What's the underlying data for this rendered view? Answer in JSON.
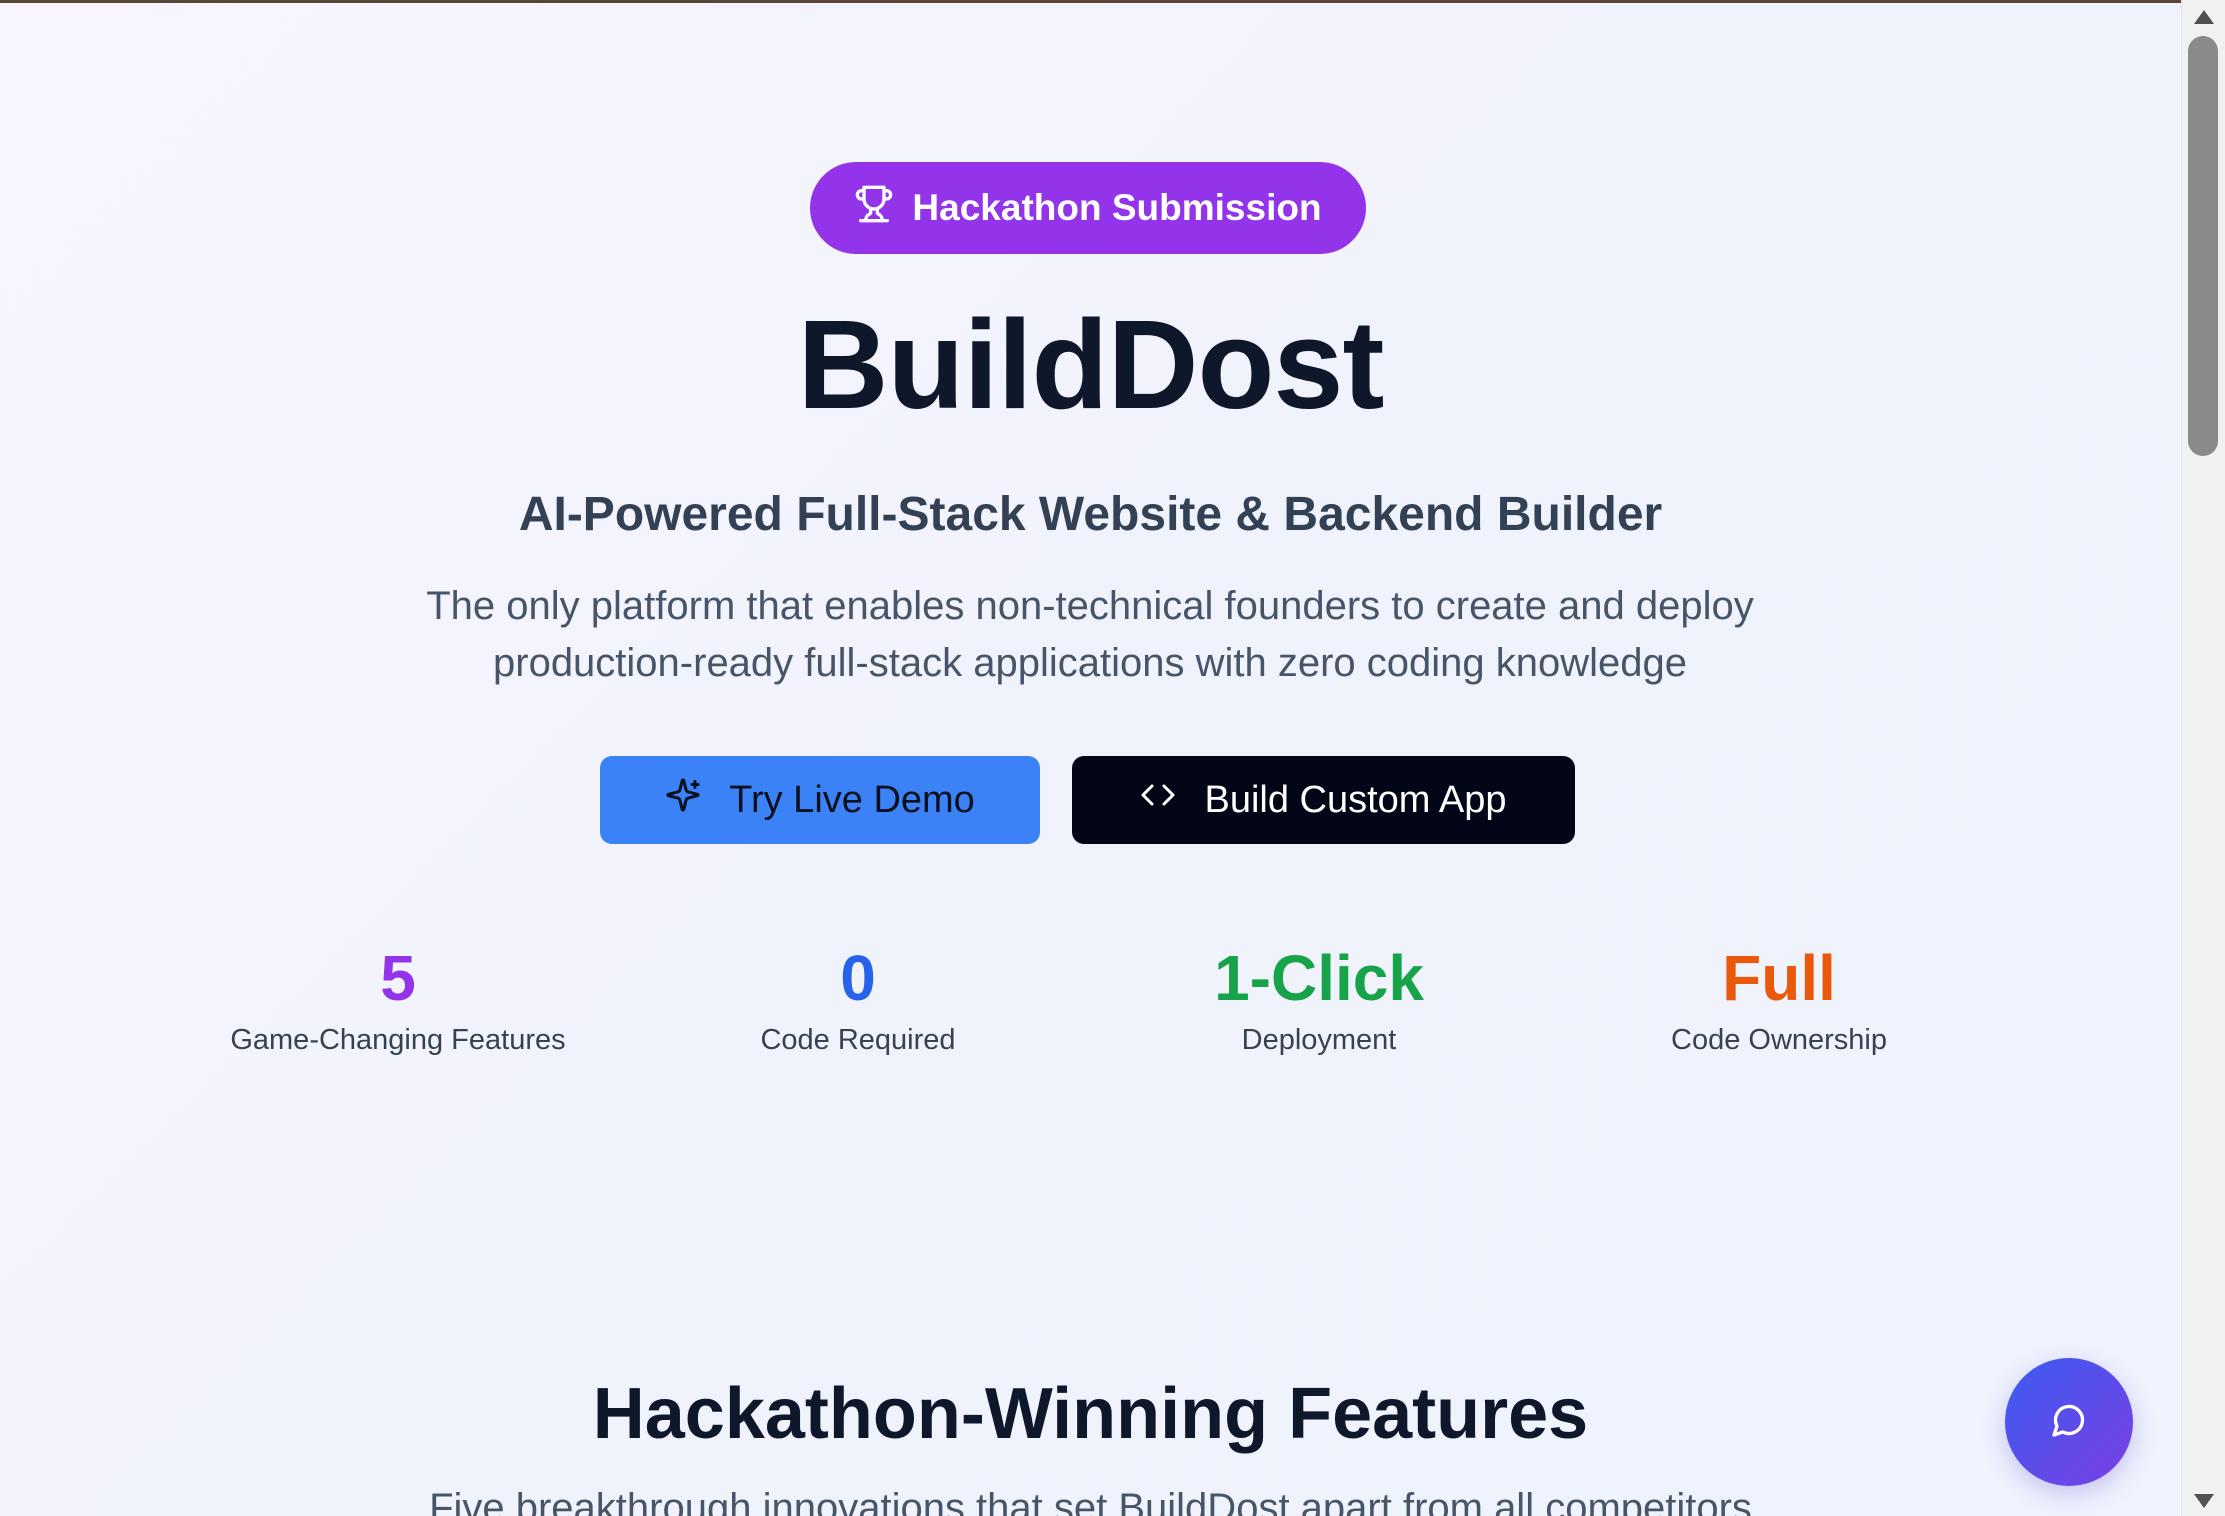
{
  "badge": {
    "label": "Hackathon Submission",
    "icon": "trophy-icon"
  },
  "hero": {
    "title": "BuildDost",
    "subtitle": "AI-Powered Full-Stack Website & Backend Builder",
    "description_line1": "The only platform that enables non-technical founders to create and deploy",
    "description_line2": "production-ready full-stack applications with zero coding knowledge"
  },
  "buttons": {
    "demo": {
      "label": "Try Live Demo",
      "icon": "sparkles-icon"
    },
    "build": {
      "label": "Build Custom App",
      "icon": "code-icon"
    }
  },
  "stats": [
    {
      "value": "5",
      "label": "Game-Changing Features",
      "color": "#9333ea"
    },
    {
      "value": "0",
      "label": "Code Required",
      "color": "#2563eb"
    },
    {
      "value": "1-Click",
      "label": "Deployment",
      "color": "#16a34a"
    },
    {
      "value": "Full",
      "label": "Code Ownership",
      "color": "#ea580c"
    }
  ],
  "features": {
    "title": "Hackathon-Winning Features",
    "subtitle": "Five breakthrough innovations that set BuildDost apart from all competitors"
  },
  "chat": {
    "icon": "chat-bubble-icon"
  },
  "colors": {
    "badge_bg": "#9333ea",
    "demo_btn_bg": "#3b82f6",
    "build_btn_bg": "#020617"
  }
}
